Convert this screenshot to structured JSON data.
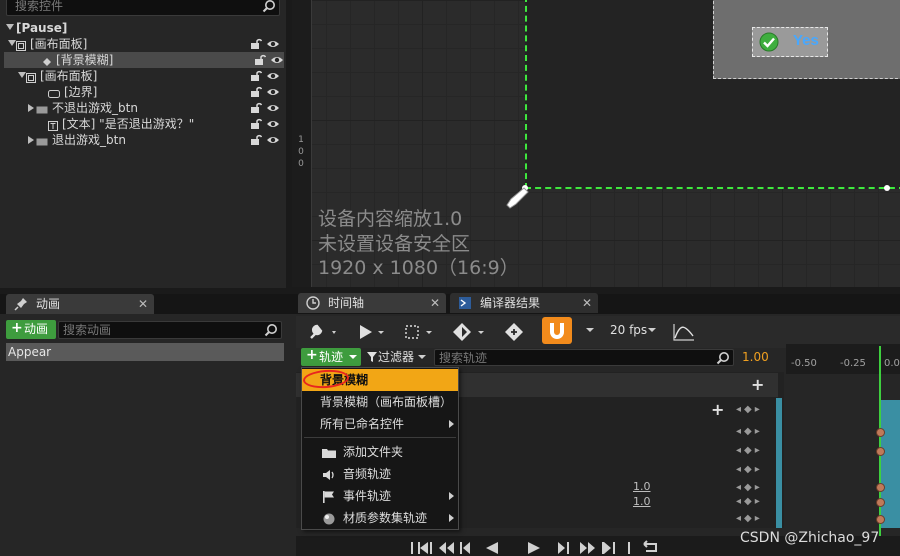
{
  "hierarchy": {
    "search_placeholder": "搜索控件",
    "items": [
      {
        "label": "[Pause]",
        "icon": "none",
        "expand": "down"
      },
      {
        "label": "[画布面板]",
        "icon": "panel-icon",
        "expand": "down"
      },
      {
        "label": "[背景模糊]",
        "icon": "blur-icon",
        "expand": "none",
        "selected": true
      },
      {
        "label": "[画布面板]",
        "icon": "panel-icon",
        "expand": "down"
      },
      {
        "label": "[边界]",
        "icon": "border-icon",
        "expand": "none"
      },
      {
        "label": "不退出游戏_btn",
        "icon": "button-icon",
        "expand": "right"
      },
      {
        "label": "[文本] \"是否退出游戏？\"",
        "icon": "text-icon",
        "expand": "none"
      },
      {
        "label": "退出游戏_btn",
        "icon": "button-icon",
        "expand": "right"
      }
    ]
  },
  "designer": {
    "ruler_label": "100",
    "dpi_lines": [
      "设备内容缩放1.0",
      "未设置设备安全区",
      "1920 x 1080（16:9）"
    ],
    "yes_label": "Yes"
  },
  "animations": {
    "tab_label": "动画",
    "add_label": "动画",
    "search_placeholder": "搜索动画",
    "items": [
      "Appear"
    ]
  },
  "timeline": {
    "tab_label": "时间轴",
    "compiler_tab_label": "编译器结果",
    "fps_label": "20 fps",
    "track_label": "轨迹",
    "filter_label": "过滤器",
    "search_placeholder": "搜索轨迹",
    "current_time": "1.00",
    "ruler_ticks": [
      "-0.50",
      "-0.25",
      "0.0"
    ],
    "values": [
      "1.0",
      "1.0"
    ],
    "keyframe_nav": "◆ ◆ ◆"
  },
  "menu": {
    "items": [
      {
        "label": "背景模糊",
        "highlighted": true,
        "submenu": false,
        "icon": "none"
      },
      {
        "label": "背景模糊（画布面板槽）",
        "highlighted": false,
        "submenu": false,
        "icon": "none"
      },
      {
        "label": "所有已命名控件",
        "highlighted": false,
        "submenu": true,
        "icon": "none"
      },
      {
        "label": "添加文件夹",
        "highlighted": false,
        "submenu": false,
        "icon": "folder-icon"
      },
      {
        "label": "音频轨迹",
        "highlighted": false,
        "submenu": false,
        "icon": "speaker-icon"
      },
      {
        "label": "事件轨迹",
        "highlighted": false,
        "submenu": true,
        "icon": "flag-icon"
      },
      {
        "label": "材质参数集轨迹",
        "highlighted": false,
        "submenu": true,
        "icon": "material-icon"
      }
    ]
  },
  "watermark": "CSDN @Zhichao_97",
  "colors": {
    "accent_green": "#3ee83e",
    "highlight_orange": "#f2a615",
    "magnet_orange": "#f28b1c",
    "teal": "#3a8fa3",
    "annotation_red": "#e8261f"
  }
}
